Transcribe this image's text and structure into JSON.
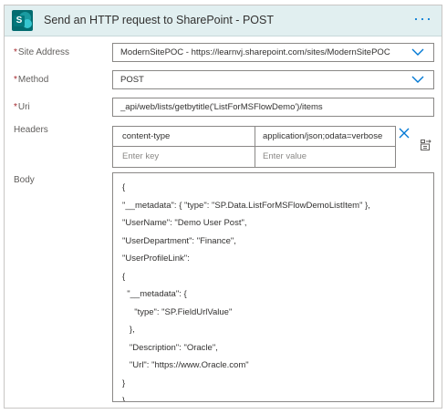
{
  "header": {
    "title": "Send an HTTP request to SharePoint - POST",
    "logo_letter": "S",
    "more_label": "···"
  },
  "fields": {
    "site_address": {
      "label": "Site Address",
      "required_mark": "*",
      "value": "ModernSitePOC - https://learnvj.sharepoint.com/sites/ModernSitePOC"
    },
    "method": {
      "label": "Method",
      "required_mark": "*",
      "value": "POST"
    },
    "uri": {
      "label": "Uri",
      "required_mark": "*",
      "value": "_api/web/lists/getbytitle('ListForMSFlowDemo')/items"
    }
  },
  "headers": {
    "label": "Headers",
    "rows": [
      {
        "key": "content-type",
        "value": "application/json;odata=verbose"
      }
    ],
    "new_row": {
      "key_placeholder": "Enter key",
      "value_placeholder": "Enter value"
    }
  },
  "body": {
    "label": "Body",
    "lines": [
      "{",
      "\"__metadata\": { \"type\": \"SP.Data.ListForMSFlowDemoListItem\" },",
      "\"UserName\": \"Demo User Post\",",
      "\"UserDepartment\": \"Finance\",",
      "\"UserProfileLink\":",
      "{",
      "  \"__metadata\": {",
      "     \"type\": \"SP.FieldUrlValue\"",
      "   },",
      "   \"Description\": \"Oracle\",",
      "   \"Url\": \"https://www.Oracle.com\"",
      "}",
      "}"
    ]
  },
  "colors": {
    "header_bg": "#e1eff0",
    "accent": "#0078d4",
    "sharepoint": "#036c70",
    "required": "#a4262c",
    "border": "#8a8886"
  }
}
